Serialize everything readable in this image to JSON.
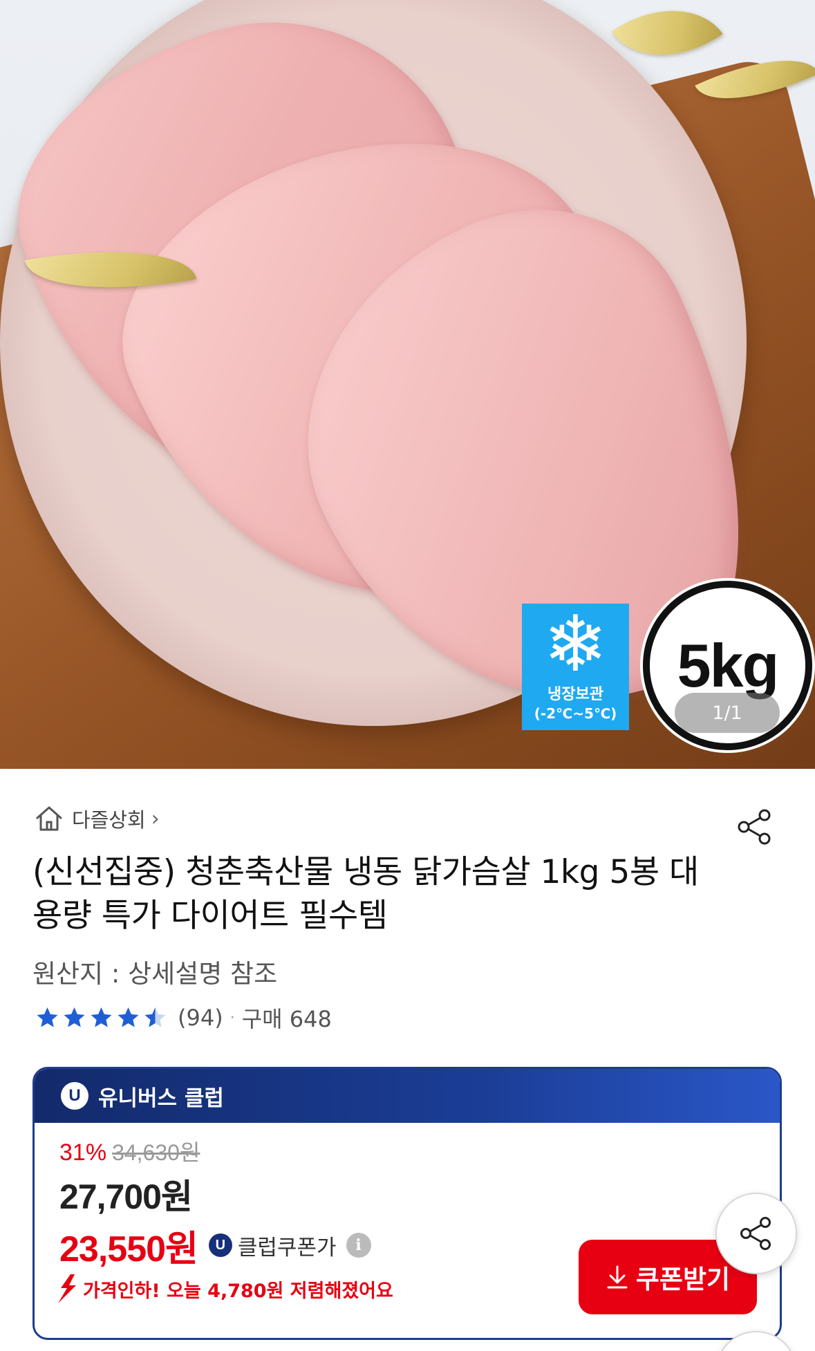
{
  "product_image": {
    "freeze_badge": {
      "line1": "냉장보관",
      "line2": "(-2℃~5℃)"
    },
    "weight_badge": "5kg",
    "page_counter": "1/1"
  },
  "seller": {
    "name": "다즐상회",
    "chevron": "›"
  },
  "product": {
    "title": "(신선집중) 청춘축산물 냉동 닭가슴살 1kg 5봉 대용량 특가 다이어트 필수템",
    "origin": "원산지 : 상세설명 참조"
  },
  "rating": {
    "stars": 4.5,
    "max": 5,
    "review_count": "(94)",
    "separator": "·",
    "purchases": "구매 648",
    "star_color": "#1f5fd6"
  },
  "club": {
    "label": "유니버스 클럽",
    "badge_letter": "U",
    "discount_rate": "31%",
    "original_price": "34,630원",
    "sale_price": "27,700원",
    "coupon_price": "23,550원",
    "coupon_label": "클럽쿠폰가",
    "price_drop_text": "가격인하! 오늘 4,780원 저렴해졌어요",
    "coupon_button": "쿠폰받기"
  },
  "colors": {
    "accent_red": "#e60012",
    "club_navy": "#17307a"
  },
  "icons": [
    "home-icon",
    "share-icon",
    "info-icon",
    "price-drop-arrow-icon",
    "download-icon",
    "scroll-top-icon"
  ]
}
